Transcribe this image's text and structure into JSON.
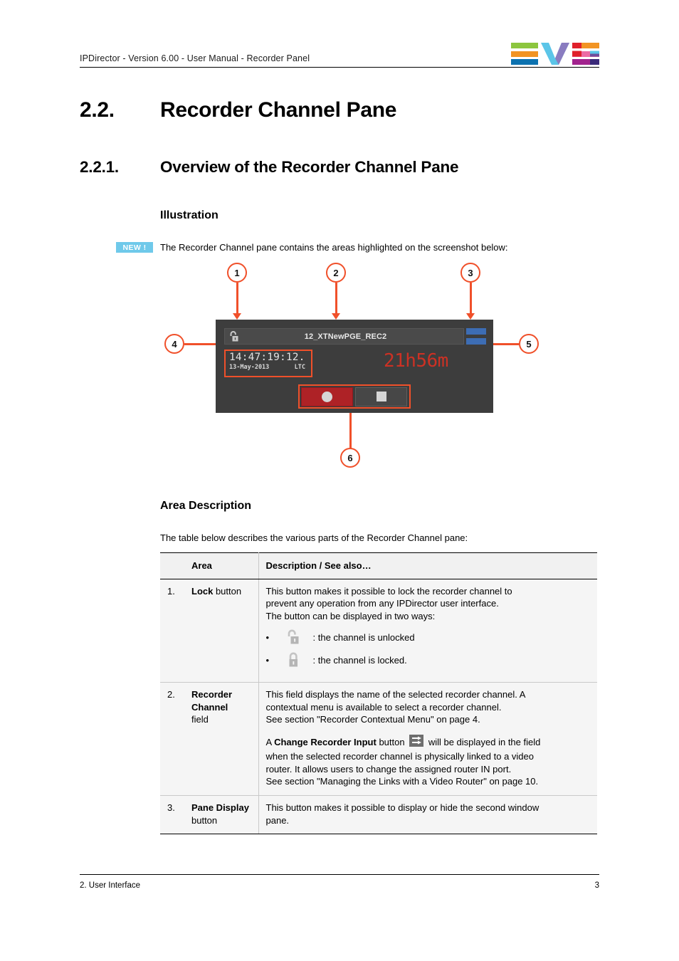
{
  "header": {
    "title": "IPDirector - Version 6.00 - User Manual - Recorder Panel",
    "logo_name": "evs-logo"
  },
  "headings": {
    "h1_number": "2.2.",
    "h1_text": "Recorder Channel Pane",
    "h2_number": "2.2.1.",
    "h2_text": "Overview of the Recorder Channel Pane",
    "h3_illustration": "Illustration",
    "h3_area_description": "Area Description"
  },
  "intro": {
    "badge": "NEW !",
    "text": "The Recorder Channel pane contains the areas highlighted on the screenshot below:"
  },
  "illustration": {
    "channel_name": "12_XTNewPGE_REC2",
    "timecode": "14:47:19:12.",
    "date": "13-May-2013",
    "timecode_source": "LTC",
    "remaining_time": "21h56m",
    "callouts": [
      "1",
      "2",
      "3",
      "4",
      "5",
      "6"
    ],
    "colors": {
      "panel_bg": "#3d3d3d",
      "field_bg": "#4a4a4a",
      "callout_orange": "#f0502a",
      "remaining_red": "#cc3124",
      "record_red": "#ae2226",
      "pane_blue": "#3d6db4"
    }
  },
  "table_intro": "The table below describes the various parts of the Recorder Channel pane:",
  "table": {
    "headers": [
      "Area",
      "Description / See also…"
    ],
    "rows": [
      {
        "num": "1.",
        "area_bold": "Lock",
        "area_rest": " button",
        "desc_line1": "This button makes it possible to lock the recorder channel to",
        "desc_line2": "prevent any operation from any IPDirector user interface.",
        "desc_line3": "The button can be displayed in two ways:",
        "bullets": [
          {
            "icon": "padlock-open-icon",
            "text": ": the channel is unlocked"
          },
          {
            "icon": "padlock-closed-icon",
            "text": ": the channel is locked."
          }
        ]
      },
      {
        "num": "2.",
        "area_bold": "Recorder Channel",
        "area_rest": "field",
        "desc_line1": "This field displays the name of the selected recorder channel. A",
        "desc_line2": "contextual menu is available to select a recorder channel.",
        "desc_line3": "See section \"Recorder Contextual Menu\" on page 4.",
        "para2_pre": "A ",
        "para2_bold": "Change Recorder Input",
        "para2_mid": " button ",
        "para2_icon": "change-recorder-input-icon",
        "para2_post": " will be displayed in the field",
        "para2_line2": "when the selected recorder channel is physically linked to a video",
        "para2_line3": "router. It allows users to change the assigned router IN port.",
        "para2_line4": "See section \"Managing the Links with a Video Router\" on page 10."
      },
      {
        "num": "3.",
        "area_bold": "Pane Display",
        "area_rest": "button",
        "desc_line1": "This button makes it possible to display or hide the second window",
        "desc_line2": "pane."
      }
    ]
  },
  "footer": {
    "section": "2. User Interface",
    "page": "3"
  }
}
